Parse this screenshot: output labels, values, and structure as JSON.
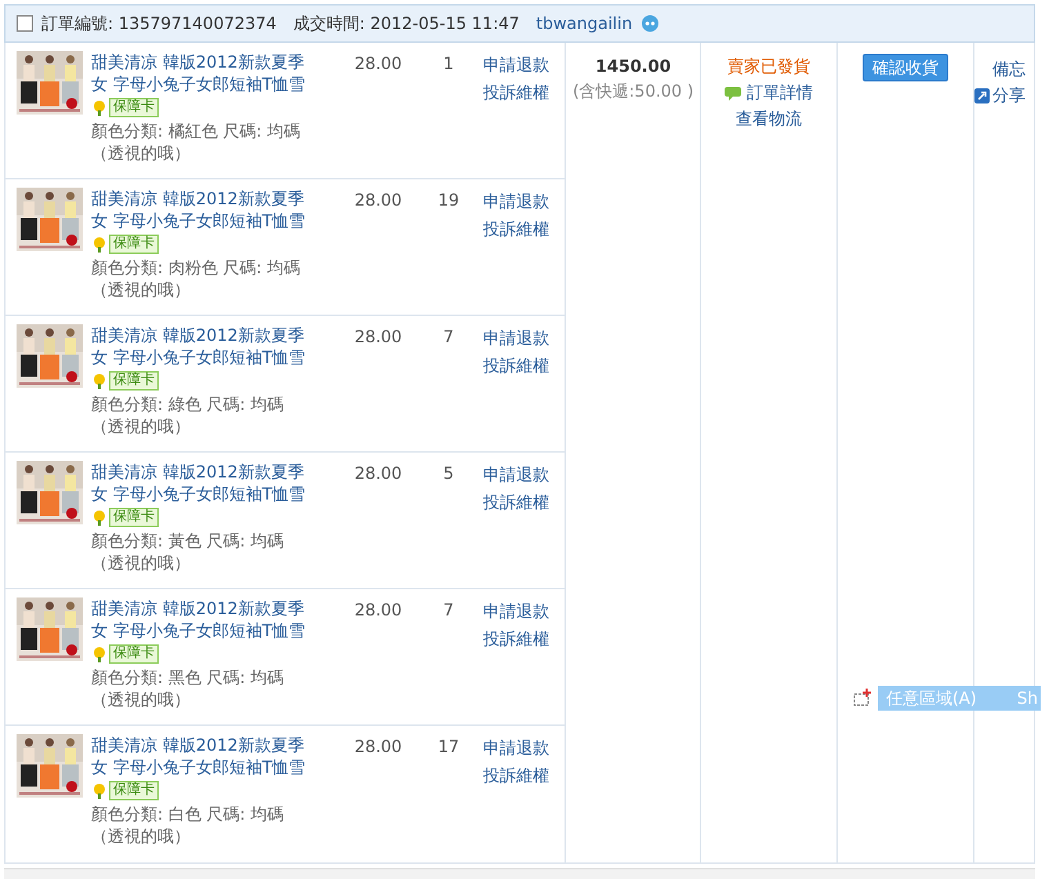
{
  "header": {
    "checked": false,
    "order_no": "訂單編號: 135797140072374",
    "time": "成交時間: 2012-05-15 11:47",
    "seller": "tbwangailin"
  },
  "items": [
    {
      "title": "甜美清凉 韓版2012新款夏季女 字母小兔子女郎短袖T恤雪",
      "badge": "保障卡",
      "spec": "顏色分類: 橘紅色 尺碼: 均碼",
      "note": "（透視的哦）",
      "price": "28.00",
      "qty": "1",
      "actions": [
        "申請退款",
        "投訴維權"
      ]
    },
    {
      "title": "甜美清凉 韓版2012新款夏季女 字母小兔子女郎短袖T恤雪",
      "badge": "保障卡",
      "spec": "顏色分類: 肉粉色 尺碼: 均碼",
      "note": "（透視的哦）",
      "price": "28.00",
      "qty": "19",
      "actions": [
        "申請退款",
        "投訴維權"
      ]
    },
    {
      "title": "甜美清凉 韓版2012新款夏季女 字母小兔子女郎短袖T恤雪",
      "badge": "保障卡",
      "spec": "顏色分類: 綠色 尺碼: 均碼",
      "note": "（透視的哦）",
      "price": "28.00",
      "qty": "7",
      "actions": [
        "申請退款",
        "投訴維權"
      ]
    },
    {
      "title": "甜美清凉 韓版2012新款夏季女 字母小兔子女郎短袖T恤雪",
      "badge": "保障卡",
      "spec": "顏色分類: 黃色 尺碼: 均碼",
      "note": "（透視的哦）",
      "price": "28.00",
      "qty": "5",
      "actions": [
        "申請退款",
        "投訴維權"
      ]
    },
    {
      "title": "甜美清凉 韓版2012新款夏季女 字母小兔子女郎短袖T恤雪",
      "badge": "保障卡",
      "spec": "顏色分類: 黑色 尺碼: 均碼",
      "note": "（透視的哦）",
      "price": "28.00",
      "qty": "7",
      "actions": [
        "申請退款",
        "投訴維權"
      ]
    },
    {
      "title": "甜美清凉 韓版2012新款夏季女 字母小兔子女郎短袖T恤雪",
      "badge": "保障卡",
      "spec": "顏色分類: 白色 尺碼: 均碼",
      "note": "（透視的哦）",
      "price": "28.00",
      "qty": "17",
      "actions": [
        "申請退款",
        "投訴維權"
      ]
    }
  ],
  "order": {
    "total": "1450.00",
    "shipping": "(含快遞:50.00 )",
    "status": "賣家已發貨",
    "details": "訂單詳情",
    "logistics": "查看物流",
    "confirm": "確認收貨",
    "memo": "備忘",
    "share": "分享"
  },
  "context_menu": [
    {
      "label": "任意區域(A)",
      "shortcut": "Sh",
      "selected": true
    }
  ]
}
